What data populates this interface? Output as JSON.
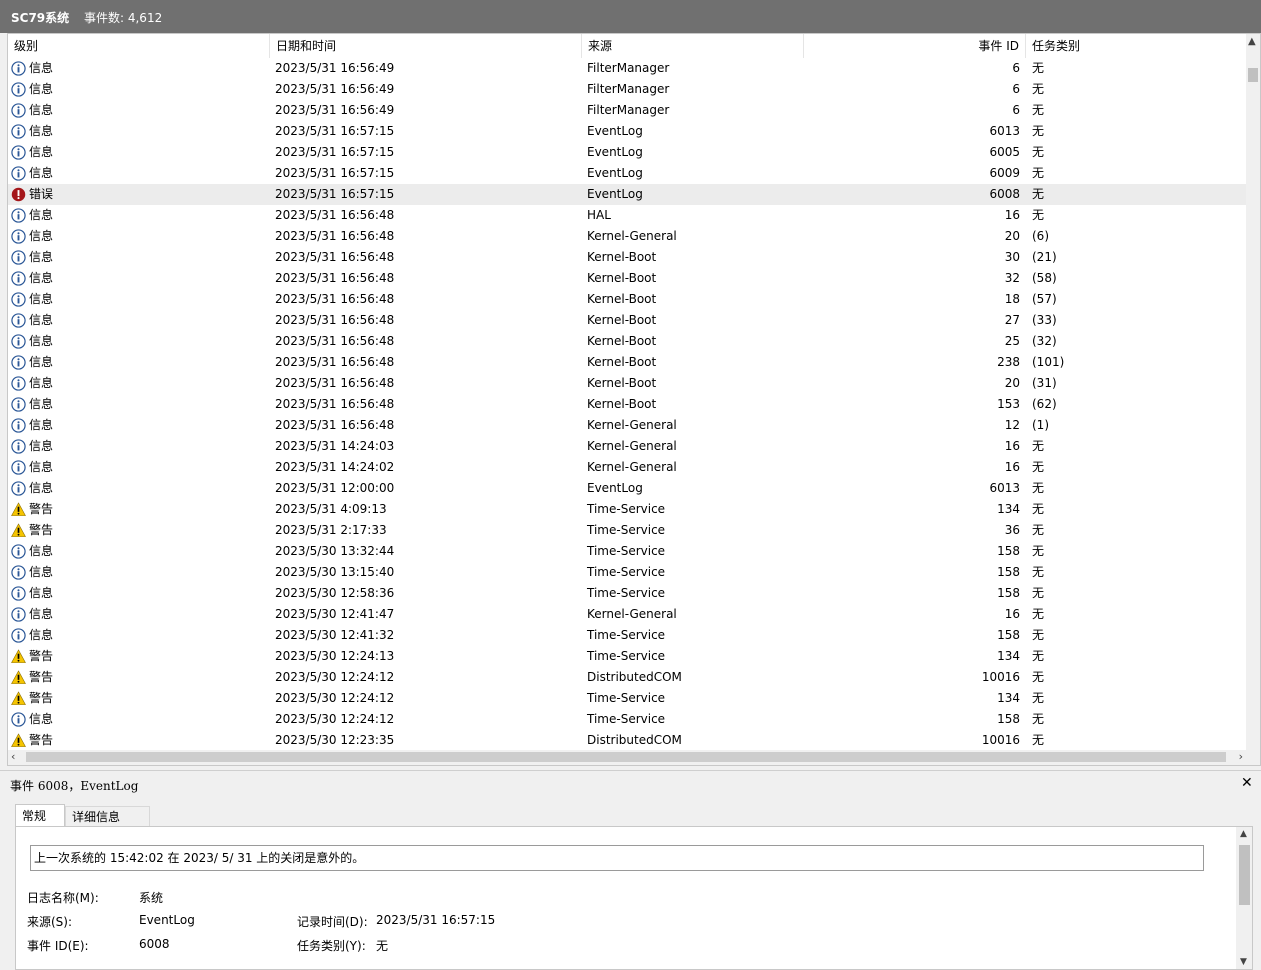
{
  "window": {
    "title": "SC79系统",
    "event_count": "事件数: 4,612"
  },
  "columns": {
    "level": "级别",
    "date": "日期和时间",
    "source": "来源",
    "event_id": "事件 ID",
    "task": "任务类别"
  },
  "rows": [
    {
      "icon": "info",
      "level": "信息",
      "date": "2023/5/31 16:56:49",
      "source": "FilterManager",
      "id": "6",
      "task": "无"
    },
    {
      "icon": "info",
      "level": "信息",
      "date": "2023/5/31 16:56:49",
      "source": "FilterManager",
      "id": "6",
      "task": "无"
    },
    {
      "icon": "info",
      "level": "信息",
      "date": "2023/5/31 16:56:49",
      "source": "FilterManager",
      "id": "6",
      "task": "无"
    },
    {
      "icon": "info",
      "level": "信息",
      "date": "2023/5/31 16:57:15",
      "source": "EventLog",
      "id": "6013",
      "task": "无"
    },
    {
      "icon": "info",
      "level": "信息",
      "date": "2023/5/31 16:57:15",
      "source": "EventLog",
      "id": "6005",
      "task": "无"
    },
    {
      "icon": "info",
      "level": "信息",
      "date": "2023/5/31 16:57:15",
      "source": "EventLog",
      "id": "6009",
      "task": "无"
    },
    {
      "icon": "error",
      "level": "错误",
      "date": "2023/5/31 16:57:15",
      "source": "EventLog",
      "id": "6008",
      "task": "无",
      "selected": true
    },
    {
      "icon": "info",
      "level": "信息",
      "date": "2023/5/31 16:56:48",
      "source": "HAL",
      "id": "16",
      "task": "无"
    },
    {
      "icon": "info",
      "level": "信息",
      "date": "2023/5/31 16:56:48",
      "source": "Kernel-General",
      "id": "20",
      "task": "(6)"
    },
    {
      "icon": "info",
      "level": "信息",
      "date": "2023/5/31 16:56:48",
      "source": "Kernel-Boot",
      "id": "30",
      "task": "(21)"
    },
    {
      "icon": "info",
      "level": "信息",
      "date": "2023/5/31 16:56:48",
      "source": "Kernel-Boot",
      "id": "32",
      "task": "(58)"
    },
    {
      "icon": "info",
      "level": "信息",
      "date": "2023/5/31 16:56:48",
      "source": "Kernel-Boot",
      "id": "18",
      "task": "(57)"
    },
    {
      "icon": "info",
      "level": "信息",
      "date": "2023/5/31 16:56:48",
      "source": "Kernel-Boot",
      "id": "27",
      "task": "(33)"
    },
    {
      "icon": "info",
      "level": "信息",
      "date": "2023/5/31 16:56:48",
      "source": "Kernel-Boot",
      "id": "25",
      "task": "(32)"
    },
    {
      "icon": "info",
      "level": "信息",
      "date": "2023/5/31 16:56:48",
      "source": "Kernel-Boot",
      "id": "238",
      "task": "(101)"
    },
    {
      "icon": "info",
      "level": "信息",
      "date": "2023/5/31 16:56:48",
      "source": "Kernel-Boot",
      "id": "20",
      "task": "(31)"
    },
    {
      "icon": "info",
      "level": "信息",
      "date": "2023/5/31 16:56:48",
      "source": "Kernel-Boot",
      "id": "153",
      "task": "(62)"
    },
    {
      "icon": "info",
      "level": "信息",
      "date": "2023/5/31 16:56:48",
      "source": "Kernel-General",
      "id": "12",
      "task": "(1)"
    },
    {
      "icon": "info",
      "level": "信息",
      "date": "2023/5/31 14:24:03",
      "source": "Kernel-General",
      "id": "16",
      "task": "无"
    },
    {
      "icon": "info",
      "level": "信息",
      "date": "2023/5/31 14:24:02",
      "source": "Kernel-General",
      "id": "16",
      "task": "无"
    },
    {
      "icon": "info",
      "level": "信息",
      "date": "2023/5/31 12:00:00",
      "source": "EventLog",
      "id": "6013",
      "task": "无"
    },
    {
      "icon": "warning",
      "level": "警告",
      "date": "2023/5/31 4:09:13",
      "source": "Time-Service",
      "id": "134",
      "task": "无"
    },
    {
      "icon": "warning",
      "level": "警告",
      "date": "2023/5/31 2:17:33",
      "source": "Time-Service",
      "id": "36",
      "task": "无"
    },
    {
      "icon": "info",
      "level": "信息",
      "date": "2023/5/30 13:32:44",
      "source": "Time-Service",
      "id": "158",
      "task": "无"
    },
    {
      "icon": "info",
      "level": "信息",
      "date": "2023/5/30 13:15:40",
      "source": "Time-Service",
      "id": "158",
      "task": "无"
    },
    {
      "icon": "info",
      "level": "信息",
      "date": "2023/5/30 12:58:36",
      "source": "Time-Service",
      "id": "158",
      "task": "无"
    },
    {
      "icon": "info",
      "level": "信息",
      "date": "2023/5/30 12:41:47",
      "source": "Kernel-General",
      "id": "16",
      "task": "无"
    },
    {
      "icon": "info",
      "level": "信息",
      "date": "2023/5/30 12:41:32",
      "source": "Time-Service",
      "id": "158",
      "task": "无"
    },
    {
      "icon": "warning",
      "level": "警告",
      "date": "2023/5/30 12:24:13",
      "source": "Time-Service",
      "id": "134",
      "task": "无"
    },
    {
      "icon": "warning",
      "level": "警告",
      "date": "2023/5/30 12:24:12",
      "source": "DistributedCOM",
      "id": "10016",
      "task": "无"
    },
    {
      "icon": "warning",
      "level": "警告",
      "date": "2023/5/30 12:24:12",
      "source": "Time-Service",
      "id": "134",
      "task": "无"
    },
    {
      "icon": "info",
      "level": "信息",
      "date": "2023/5/30 12:24:12",
      "source": "Time-Service",
      "id": "158",
      "task": "无"
    },
    {
      "icon": "warning",
      "level": "警告",
      "date": "2023/5/30 12:23:35",
      "source": "DistributedCOM",
      "id": "10016",
      "task": "无"
    }
  ],
  "detail": {
    "header": "事件 6008，EventLog",
    "tabs": [
      "常规",
      "详细信息"
    ],
    "message": "上一次系统的 15:42:02 在    2023/   5/   31 上的关闭是意外的。",
    "fields": {
      "log_name_label": "日志名称(M):",
      "log_name_value": "系统",
      "source_label": "来源(S):",
      "source_value": "EventLog",
      "logged_label": "记录时间(D):",
      "logged_value": "2023/5/31 16:57:15",
      "event_id_label": "事件 ID(E):",
      "event_id_value": "6008",
      "task_label": "任务类别(Y):",
      "task_value": "无"
    }
  },
  "colors": {
    "info": "#2b5797",
    "error": "#a4161a",
    "warning": "#f5c400",
    "titlebar": "#707070",
    "selected_row": "#ececec"
  }
}
